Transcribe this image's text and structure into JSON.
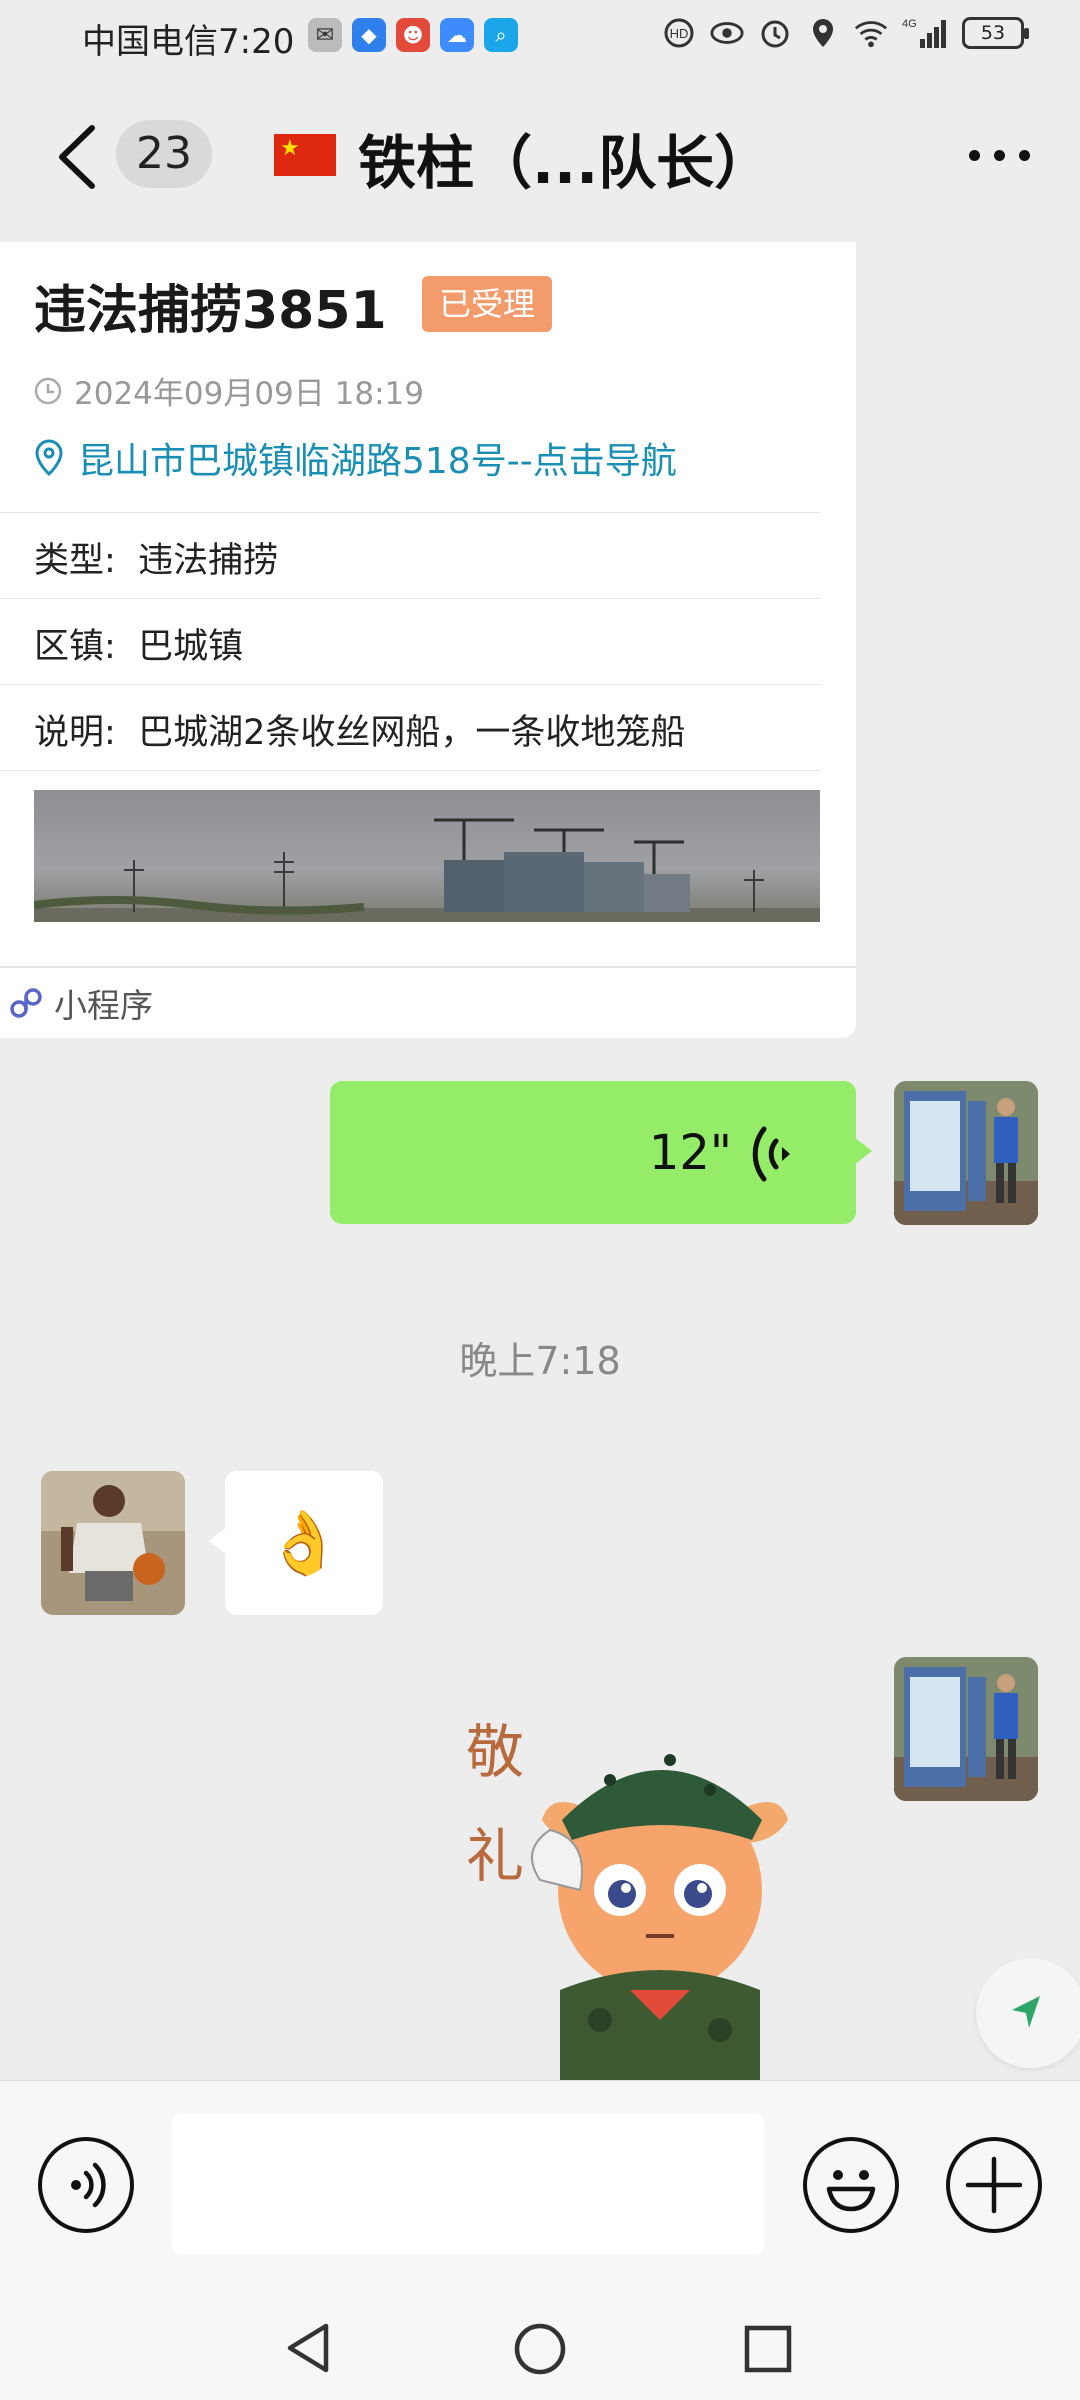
{
  "status_bar": {
    "carrier_time": "中国电信7:20",
    "battery": "53",
    "network": "4G"
  },
  "header": {
    "unread_count": "23",
    "title": "铁柱（...队长）"
  },
  "card": {
    "title": "违法捕捞3851",
    "status_badge": "已受理",
    "time": "2024年09月09日 18:19",
    "address": "昆山市巴城镇临湖路518号--点击导航",
    "rows": [
      {
        "label": "类型:",
        "value": "违法捕捞"
      },
      {
        "label": "区镇:",
        "value": "巴城镇"
      },
      {
        "label": "说明:",
        "value": "巴城湖2条收丝网船，一条收地笼船"
      }
    ],
    "footer_label": "小程序"
  },
  "voice_message": {
    "duration": "12\""
  },
  "timestamp": "晚上7:18",
  "emoji_message": {
    "emoji": "👌"
  },
  "sticker": {
    "text": "敬礼"
  },
  "colors": {
    "chat_bg": "#ededed",
    "bubble_green": "#95ec69",
    "badge_orange": "#f49b6c",
    "link_blue": "#1a8fb5"
  },
  "icons": {
    "back": "back-arrow-icon",
    "more": "more-dots-icon",
    "voice_input": "voice-input-icon",
    "emoji": "emoji-smile-icon",
    "plus": "plus-icon"
  }
}
